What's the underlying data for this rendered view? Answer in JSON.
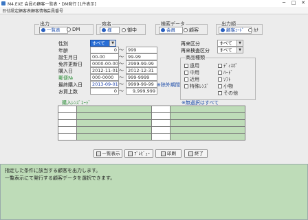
{
  "window": {
    "title": "M4.EXE  会員の顧客一覧表・DM発行 [1件表示]",
    "min": "─",
    "max": "□",
    "close": "✕"
  },
  "menu": [
    "日付設定",
    "顧客表",
    "顧客情報",
    "会員番号"
  ],
  "output_group": {
    "legend": "出力",
    "options": [
      "一覧表",
      "DM"
    ],
    "selected": "一覧表"
  },
  "honorific_group": {
    "legend": "宛名",
    "options": [
      "様",
      "御中"
    ],
    "selected": "様"
  },
  "search_data_group": {
    "legend": "検索データ",
    "options": [
      "会員",
      "顧客"
    ],
    "selected": "会員"
  },
  "order_group": {
    "legend": "出力順",
    "options": [
      "顧客ｺｰﾄﾞ",
      "ｶﾅ"
    ],
    "selected": "顧客ｺｰﾄﾞ"
  },
  "fields": {
    "gender": {
      "label": "性別",
      "value": "すべて"
    },
    "age": {
      "label": "年齢",
      "from": "0",
      "to": "999"
    },
    "birthday": {
      "label": "誕生月日",
      "from": "00-00",
      "to": "99-99"
    },
    "license_renewal": {
      "label": "免許更新日",
      "from": "0000-00-00",
      "to": "2999-99-99"
    },
    "purchase_date": {
      "label": "購入日",
      "from": "2012-11-01",
      "to": "2012-12-31"
    },
    "postal_code": {
      "label": "郵便№",
      "from": "000-0000",
      "to": "999-9999"
    },
    "last_purchase": {
      "label": "最終購入日",
      "from": "2013-09-01",
      "to": "9999-99-99"
    },
    "purchase_count": {
      "label": "お買上数",
      "from": "0",
      "to": "9,999,999"
    },
    "exclusion_note": "※除外期間",
    "regular_type": {
      "label": "再来区分",
      "value": "すべて"
    },
    "regular_exam": {
      "label": "再来検査区分",
      "value": "すべて"
    }
  },
  "product_group": {
    "legend": "商品種類",
    "items": [
      [
        "遠用",
        "ﾃﾞｨｽﾎﾟ"
      ],
      [
        "中用",
        "ﾊｰﾄﾞ"
      ],
      [
        "近用",
        "ｿﾌﾄ"
      ],
      [
        "特殊ﾚﾝｽﾞ",
        "小物"
      ],
      [
        "",
        "その他"
      ]
    ]
  },
  "purchase_label": "購入ﾚﾝｽﾞｺｰﾄﾞ",
  "unselected_note": "※無選択はすべて",
  "buttons": {
    "list": "一覧表示",
    "preview": "ﾌﾟﾚﾋﾞｭｰ",
    "print": "印刷",
    "close": "終了"
  },
  "status": {
    "line1": "指定した条件に該当する顧客を出力します。",
    "line2": "一覧表示にて発行する顧客データを選択できます。"
  },
  "colors": {
    "accent": "#2a60c0",
    "label_green": "#2f8f3a",
    "grid_fill": "#bedcb8",
    "status_fill": "#bedcb8"
  }
}
